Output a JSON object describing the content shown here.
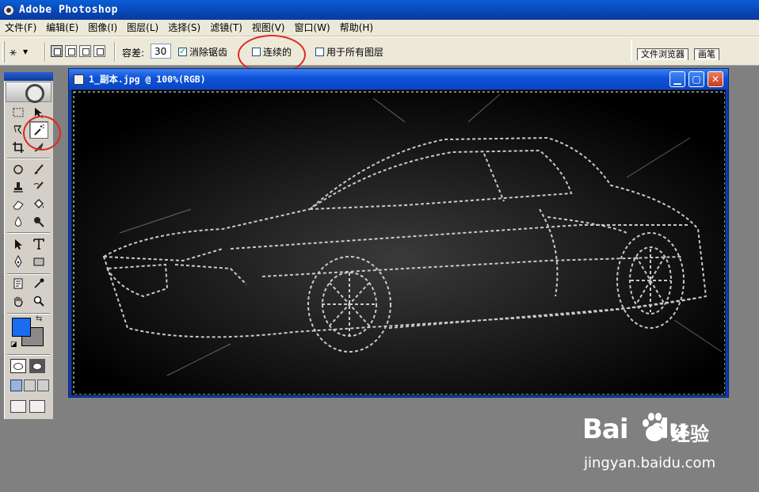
{
  "app": {
    "title": "Adobe Photoshop"
  },
  "menu": {
    "items": [
      "文件(F)",
      "编辑(E)",
      "图像(I)",
      "图层(L)",
      "选择(S)",
      "滤镜(T)",
      "视图(V)",
      "窗口(W)",
      "帮助(H)"
    ]
  },
  "options_bar": {
    "tolerance_label": "容差:",
    "tolerance_value": "30",
    "antialias_label": "消除锯齿",
    "antialias_checked": true,
    "contiguous_label": "连续的",
    "contiguous_checked": false,
    "all_layers_label": "用于所有图层",
    "all_layers_checked": false
  },
  "palette_well": {
    "tabs": [
      "文件浏览器",
      "画笔"
    ]
  },
  "toolbox": {
    "active_tool": "magic-wand",
    "foreground_color": "#1a6cf0",
    "background_color": "#8a8a8a"
  },
  "document": {
    "title": "1_副本.jpg @ 100%(RGB)"
  },
  "annotations": {
    "highlight_color": "#e0281f"
  },
  "watermark": {
    "brand": "Bai",
    "brand_suffix": "du",
    "jingyan": "经验",
    "url": "jingyan.baidu.com"
  }
}
